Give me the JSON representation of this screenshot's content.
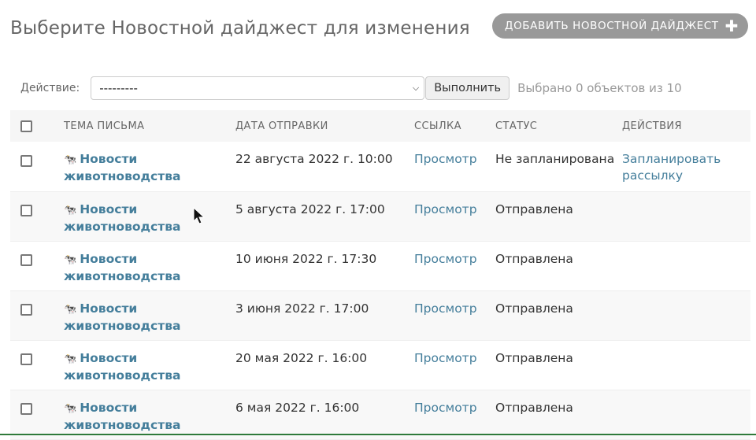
{
  "header": {
    "title": "Выберите Новостной дайджест для изменения",
    "add_button_label": "Добавить Новостной дайджест",
    "add_icon": "plus-icon"
  },
  "actions": {
    "label": "Действие:",
    "selected_option": "---------",
    "go_button_label": "Выполнить",
    "selection_counter": "Выбрано 0 объектов из 10"
  },
  "table": {
    "columns": [
      "Тема письма",
      "Дата отправки",
      "Ссылка",
      "Статус",
      "Действия"
    ],
    "rows": [
      {
        "subject": "Новости животноводства",
        "date": "22 августа 2022 г. 10:00",
        "link": "Просмотр",
        "status": "Не запланирована",
        "action": "Запланировать рассылку"
      },
      {
        "subject": "Новости животноводства",
        "date": "5 августа 2022 г. 17:00",
        "link": "Просмотр",
        "status": "Отправлена",
        "action": ""
      },
      {
        "subject": "Новости животноводства",
        "date": "10 июня 2022 г. 17:30",
        "link": "Просмотр",
        "status": "Отправлена",
        "action": ""
      },
      {
        "subject": "Новости животноводства",
        "date": "3 июня 2022 г. 17:00",
        "link": "Просмотр",
        "status": "Отправлена",
        "action": ""
      },
      {
        "subject": "Новости животноводства",
        "date": "20 мая 2022 г. 16:00",
        "link": "Просмотр",
        "status": "Отправлена",
        "action": ""
      },
      {
        "subject": "Новости животноводства",
        "date": "6 мая 2022 г. 16:00",
        "link": "Просмотр",
        "status": "Отправлена",
        "action": ""
      }
    ]
  },
  "colors": {
    "link": "#447e9b",
    "add_button_bg": "#999999"
  }
}
